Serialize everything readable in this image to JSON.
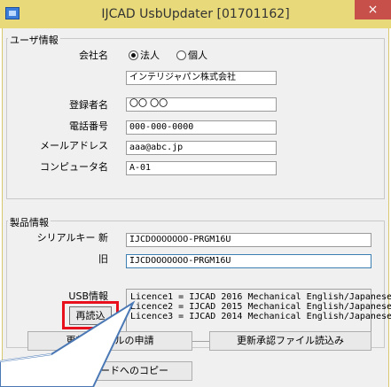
{
  "window": {
    "title": "IJCAD UsbUpdater [01701162]",
    "close_glyph": "×"
  },
  "user_info": {
    "group_title": "ユーザ情報",
    "company_label": "会社名",
    "radio_corporate": "法人",
    "radio_individual": "個人",
    "selected": "法人",
    "company_value": "インテリジャパン株式会社",
    "registrant_label": "登録者名",
    "registrant_value": "〇〇 〇〇",
    "phone_label": "電話番号",
    "phone_value": "000-000-0000",
    "email_label": "メールアドレス",
    "email_value": "aaa@abc.jp",
    "computer_label": "コンピュータ名",
    "computer_value": "A-01"
  },
  "product_info": {
    "group_title": "製品情報",
    "serial_new_label": "シリアルキー 新",
    "serial_new_value": "IJCDOOOOOOO-PRGM16U",
    "serial_old_label": "旧",
    "serial_old_value": "IJCDOOOOOOO-PRGM16U",
    "usb_label": "USB情報",
    "reload_label": "再読込",
    "usb_lines": [
      "Licence1 = IJCAD 2016 Mechanical English/Japanese",
      "Licence2 = IJCAD 2015 Mechanical English/Japanese",
      "Licence3 = IJCAD 2014 Mechanical English/Japanese"
    ]
  },
  "buttons": {
    "apply_label": "更新ファイルの申請",
    "import_label": "更新承認ファイル読込み",
    "clipboard_label": "クリップボードへのコピー"
  },
  "colors": {
    "title_bar": "#e8d97a",
    "close": "#c7504a",
    "highlight": "#e8101c",
    "callout": "#4a78b5"
  }
}
